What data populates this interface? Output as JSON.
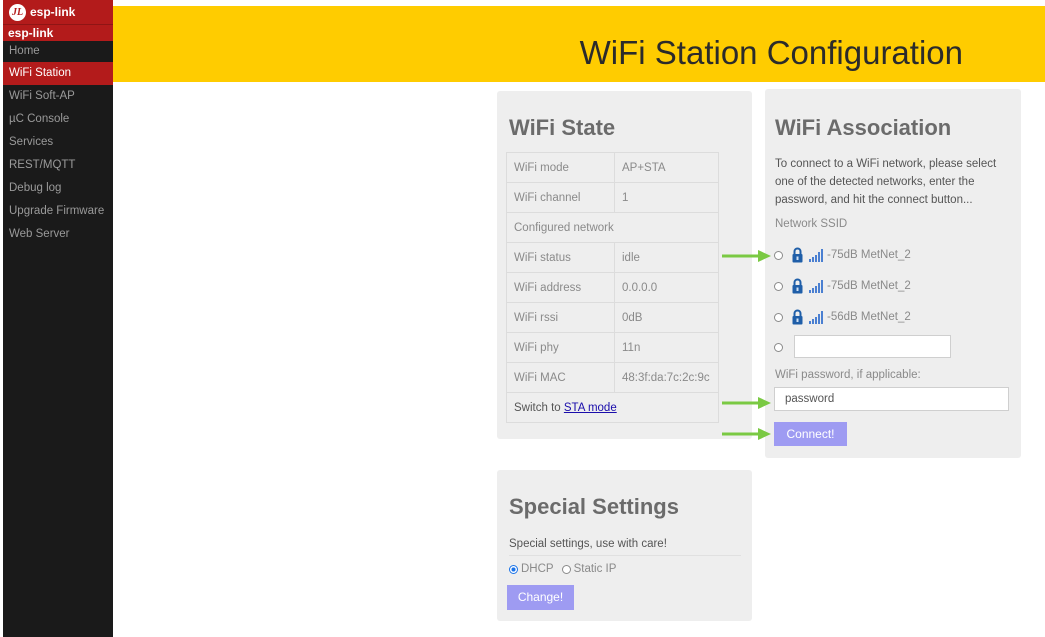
{
  "sidebar": {
    "brand": "esp-link",
    "brand_logo": "JL",
    "subtitle": "esp-link",
    "items": [
      {
        "label": "Home"
      },
      {
        "label": "WiFi Station"
      },
      {
        "label": "WiFi Soft-AP"
      },
      {
        "label": "µC Console"
      },
      {
        "label": "Services"
      },
      {
        "label": "REST/MQTT"
      },
      {
        "label": "Debug log"
      },
      {
        "label": "Upgrade Firmware"
      },
      {
        "label": "Web Server"
      }
    ],
    "active_item": "WiFi Station"
  },
  "header": {
    "title": "WiFi Station Configuration"
  },
  "wifi_state": {
    "title": "WiFi State",
    "rows": [
      {
        "label": "WiFi mode",
        "value": "AP+STA"
      },
      {
        "label": "WiFi channel",
        "value": "1"
      },
      {
        "label": "Configured network",
        "value": ""
      },
      {
        "label": "WiFi status",
        "value": "idle"
      },
      {
        "label": "WiFi address",
        "value": "0.0.0.0"
      },
      {
        "label": "WiFi rssi",
        "value": "0dB"
      },
      {
        "label": "WiFi phy",
        "value": "11n"
      },
      {
        "label": "WiFi MAC",
        "value": "48:3f:da:7c:2c:9c"
      }
    ],
    "switch_prefix": "Switch to",
    "switch_link": "STA mode"
  },
  "wifi_assoc": {
    "title": "WiFi Association",
    "description": "To connect to a WiFi network, please select one of the detected networks, enter the password, and hit the connect button...",
    "ssid_label": "Network SSID",
    "networks": [
      {
        "rssi": "-75dB",
        "ssid": "MetNet_2"
      },
      {
        "rssi": "-75dB",
        "ssid": "MetNet_2"
      },
      {
        "rssi": "-56dB",
        "ssid": "MetNet_2"
      }
    ],
    "custom_ssid_value": "",
    "password_label": "WiFi password, if applicable:",
    "password_value": "password",
    "connect_label": "Connect!"
  },
  "special": {
    "title": "Special Settings",
    "description": "Special settings, use with care!",
    "dhcp_label": "DHCP",
    "static_label": "Static IP",
    "selected": "DHCP",
    "change_label": "Change!"
  },
  "colors": {
    "header_bg": "#ffcc00",
    "sidebar_bg": "#1a1a1a",
    "brand_red": "#b31b1b",
    "button_bg": "#9e9bf2",
    "card_bg": "#eeeeee",
    "annotation_arrow": "#7ac943"
  }
}
